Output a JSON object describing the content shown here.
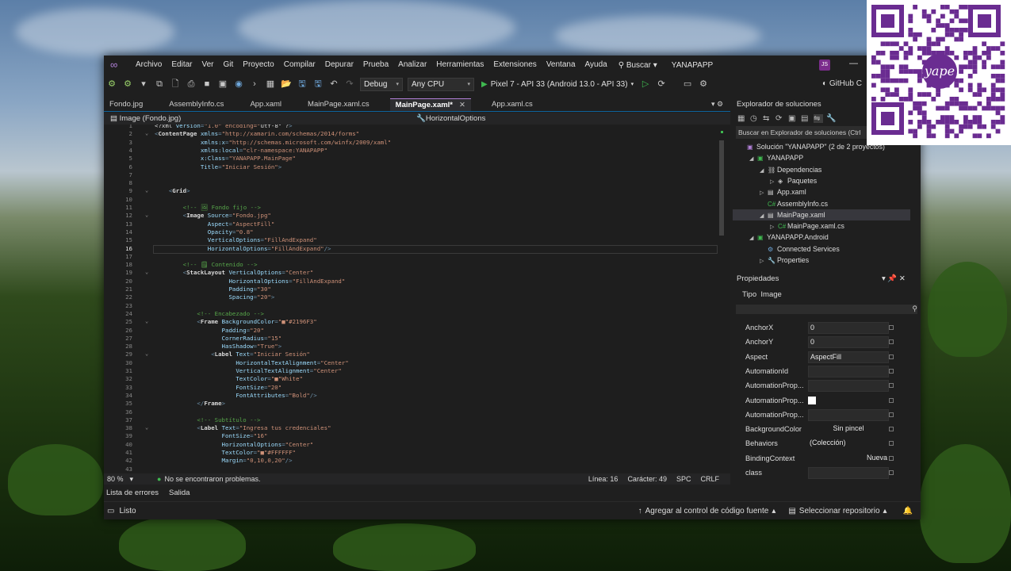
{
  "menu": {
    "items": [
      "Archivo",
      "Editar",
      "Ver",
      "Git",
      "Proyecto",
      "Compilar",
      "Depurar",
      "Prueba",
      "Analizar",
      "Herramientas",
      "Extensiones",
      "Ventana",
      "Ayuda"
    ],
    "search": "Buscar",
    "project": "YANAPAPP",
    "avatar": "JS"
  },
  "toolbar": {
    "config": "Debug",
    "platform": "Any CPU",
    "run_target": "Pixel 7 - API 33 (Android 13.0 - API 33)",
    "github": "GitHub C"
  },
  "tabs": [
    {
      "label": "Fondo.jpg",
      "active": false
    },
    {
      "label": "AssemblyInfo.cs",
      "active": false
    },
    {
      "label": "App.xaml",
      "active": false
    },
    {
      "label": "MainPage.xaml.cs",
      "active": false
    },
    {
      "label": "MainPage.xaml*",
      "active": true
    },
    {
      "label": "App.xaml.cs",
      "active": false
    }
  ],
  "navbar": {
    "left": "Image (Fondo.jpg)",
    "right": "HorizontalOptions"
  },
  "editor": {
    "current_line": 16,
    "lines": [
      {
        "n": "1",
        "t": "<?xml version=\"1.0\" encoding=\"utf-8\" ?>"
      },
      {
        "n": "2",
        "t": "<ContentPage xmlns=\"http://xamarin.com/schemas/2014/forms\""
      },
      {
        "n": "3",
        "t": "             xmlns:x=\"http://schemas.microsoft.com/winfx/2009/xaml\""
      },
      {
        "n": "4",
        "t": "             xmlns:local=\"clr-namespace:YANAPAPP\""
      },
      {
        "n": "5",
        "t": "             x:Class=\"YANAPAPP.MainPage\""
      },
      {
        "n": "6",
        "t": "             Title=\"Iniciar Sesión\">"
      },
      {
        "n": "7",
        "t": ""
      },
      {
        "n": "8",
        "t": ""
      },
      {
        "n": "9",
        "t": "    <Grid>"
      },
      {
        "n": "10",
        "t": ""
      },
      {
        "n": "11",
        "t": "        <!-- 🖼 Fondo fijo -->"
      },
      {
        "n": "12",
        "t": "        <Image Source=\"Fondo.jpg\""
      },
      {
        "n": "13",
        "t": "               Aspect=\"AspectFill\""
      },
      {
        "n": "14",
        "t": "               Opacity=\"0.8\""
      },
      {
        "n": "15",
        "t": "               VerticalOptions=\"FillAndExpand\""
      },
      {
        "n": "16",
        "t": "               HorizontalOptions=\"FillAndExpand\"/>"
      },
      {
        "n": "17",
        "t": ""
      },
      {
        "n": "18",
        "t": "        <!-- 🗒 Contenido -->"
      },
      {
        "n": "19",
        "t": "        <StackLayout VerticalOptions=\"Center\""
      },
      {
        "n": "20",
        "t": "                     HorizontalOptions=\"FillAndExpand\""
      },
      {
        "n": "21",
        "t": "                     Padding=\"30\""
      },
      {
        "n": "22",
        "t": "                     Spacing=\"20\">"
      },
      {
        "n": "23",
        "t": ""
      },
      {
        "n": "24",
        "t": "            <!-- Encabezado -->"
      },
      {
        "n": "25",
        "t": "            <Frame BackgroundColor=\"■\"#2196F3\""
      },
      {
        "n": "26",
        "t": "                   Padding=\"20\""
      },
      {
        "n": "27",
        "t": "                   CornerRadius=\"15\""
      },
      {
        "n": "28",
        "t": "                   HasShadow=\"True\">"
      },
      {
        "n": "29",
        "t": "                <Label Text=\"Iniciar Sesión\""
      },
      {
        "n": "30",
        "t": "                       HorizontalTextAlignment=\"Center\""
      },
      {
        "n": "31",
        "t": "                       VerticalTextAlignment=\"Center\""
      },
      {
        "n": "32",
        "t": "                       TextColor=\"■\"White\""
      },
      {
        "n": "33",
        "t": "                       FontSize=\"20\""
      },
      {
        "n": "34",
        "t": "                       FontAttributes=\"Bold\"/>"
      },
      {
        "n": "35",
        "t": "            </Frame>"
      },
      {
        "n": "36",
        "t": ""
      },
      {
        "n": "37",
        "t": "            <!-- Subtítulo -->"
      },
      {
        "n": "38",
        "t": "            <Label Text=\"Ingresa tus credenciales\""
      },
      {
        "n": "39",
        "t": "                   FontSize=\"16\""
      },
      {
        "n": "40",
        "t": "                   HorizontalOptions=\"Center\""
      },
      {
        "n": "41",
        "t": "                   TextColor=\"■\"#FFFFFF\""
      },
      {
        "n": "42",
        "t": "                   Margin=\"0,10,0,20\"/>"
      },
      {
        "n": "43",
        "t": ""
      }
    ]
  },
  "status": {
    "zoom": "80 %",
    "problems": "No se encontraron problemas.",
    "line": "Línea: 16",
    "char": "Carácter: 49",
    "spc": "SPC",
    "crlf": "CRLF"
  },
  "bottom_tabs": [
    "Lista de errores",
    "Salida"
  ],
  "bottombar": {
    "ready": "Listo",
    "source_control": "Agregar al control de código fuente",
    "repo": "Seleccionar repositorio"
  },
  "solution_explorer": {
    "title": "Explorador de soluciones",
    "search": "Buscar en Explorador de soluciones (Ctrl",
    "nodes": [
      {
        "label": "Solución \"YANAPAPP\" (2 de 2 proyectos)",
        "icon": "solution-icon",
        "indent": 0,
        "arrow": ""
      },
      {
        "label": "YANAPAPP",
        "icon": "csproj-icon",
        "indent": 1,
        "arrow": "◢"
      },
      {
        "label": "Dependencias",
        "icon": "dependencies-icon",
        "indent": 2,
        "arrow": "◢"
      },
      {
        "label": "Paquetes",
        "icon": "package-icon",
        "indent": 3,
        "arrow": "▷"
      },
      {
        "label": "App.xaml",
        "icon": "xaml-icon",
        "indent": 2,
        "arrow": "▷"
      },
      {
        "label": "AssemblyInfo.cs",
        "icon": "csharp-icon",
        "indent": 2,
        "arrow": ""
      },
      {
        "label": "MainPage.xaml",
        "icon": "xaml-icon",
        "indent": 2,
        "arrow": "◢"
      },
      {
        "label": "MainPage.xaml.cs",
        "icon": "csharp-icon",
        "indent": 3,
        "arrow": "▷"
      },
      {
        "label": "YANAPAPP.Android",
        "icon": "android-project-icon",
        "indent": 1,
        "arrow": "◢"
      },
      {
        "label": "Connected Services",
        "icon": "connected-services-icon",
        "indent": 2,
        "arrow": ""
      },
      {
        "label": "Properties",
        "icon": "wrench-icon",
        "indent": 2,
        "arrow": "▷"
      }
    ]
  },
  "properties": {
    "title": "Propiedades",
    "tipo_label": "Tipo",
    "tipo_value": "Image",
    "rows": [
      {
        "name": "AnchorX",
        "value": "0"
      },
      {
        "name": "AnchorY",
        "value": "0"
      },
      {
        "name": "Aspect",
        "value": "AspectFill"
      },
      {
        "name": "AutomationId",
        "value": ""
      },
      {
        "name": "AutomationProp...",
        "value": ""
      },
      {
        "name": "AutomationProp...",
        "value": ""
      },
      {
        "name": "AutomationProp...",
        "value": ""
      },
      {
        "name": "BackgroundColor",
        "value": "Sin pincel"
      },
      {
        "name": "Behaviors",
        "value": "(Colección)"
      },
      {
        "name": "BindingContext",
        "value": "Nueva"
      },
      {
        "name": "class",
        "value": ""
      }
    ]
  },
  "overlay": {
    "brand": "yape"
  },
  "colors": {
    "accent": "#b180d7",
    "run": "#3fb950",
    "qr": "#6a2c91"
  }
}
